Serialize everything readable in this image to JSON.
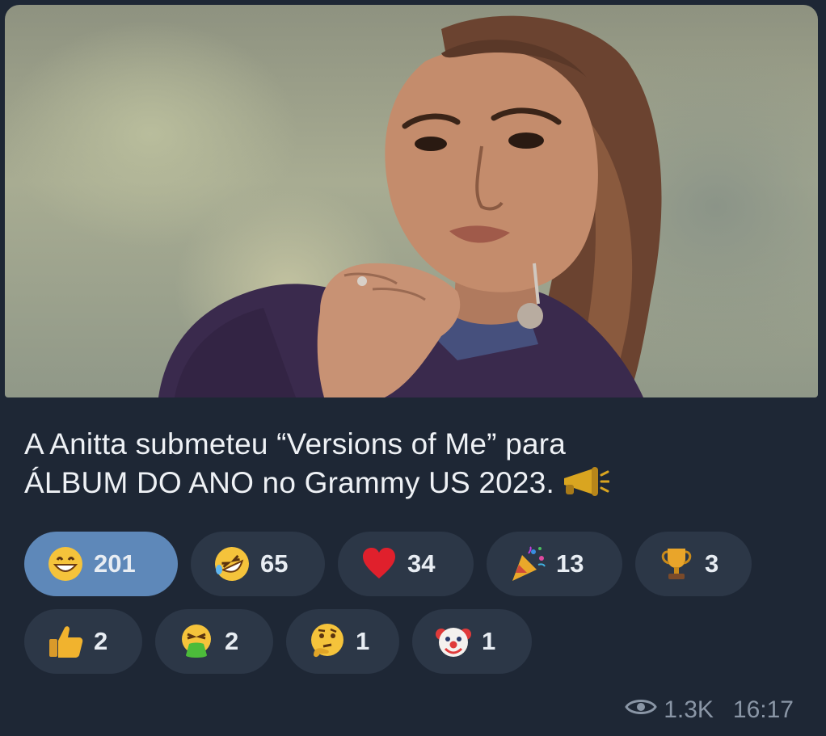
{
  "post": {
    "caption_line1": "A Anitta submeteu “Versions of Me” para",
    "caption_line2": "ÁLBUM DO ANO no Grammy US 2023.",
    "caption_emoji": "megaphone-icon",
    "views": "1.3K",
    "time": "16:17"
  },
  "reactions": [
    {
      "emoji": "grinning-face-icon",
      "count": "201",
      "active": true
    },
    {
      "emoji": "rolling-laughing-face-icon",
      "count": "65",
      "active": false
    },
    {
      "emoji": "red-heart-icon",
      "count": "34",
      "active": false
    },
    {
      "emoji": "party-popper-icon",
      "count": "13",
      "active": false
    },
    {
      "emoji": "trophy-icon",
      "count": "3",
      "active": false
    },
    {
      "emoji": "thumbs-up-icon",
      "count": "2",
      "active": false
    },
    {
      "emoji": "vomiting-face-icon",
      "count": "2",
      "active": false
    },
    {
      "emoji": "thinking-face-icon",
      "count": "1",
      "active": false
    },
    {
      "emoji": "clown-face-icon",
      "count": "1",
      "active": false
    }
  ],
  "colors": {
    "background": "#1e2735",
    "chip": "#2c3747",
    "chip_active": "#5e88b9",
    "text": "#eef1f5",
    "meta_text": "#8a96a6"
  }
}
